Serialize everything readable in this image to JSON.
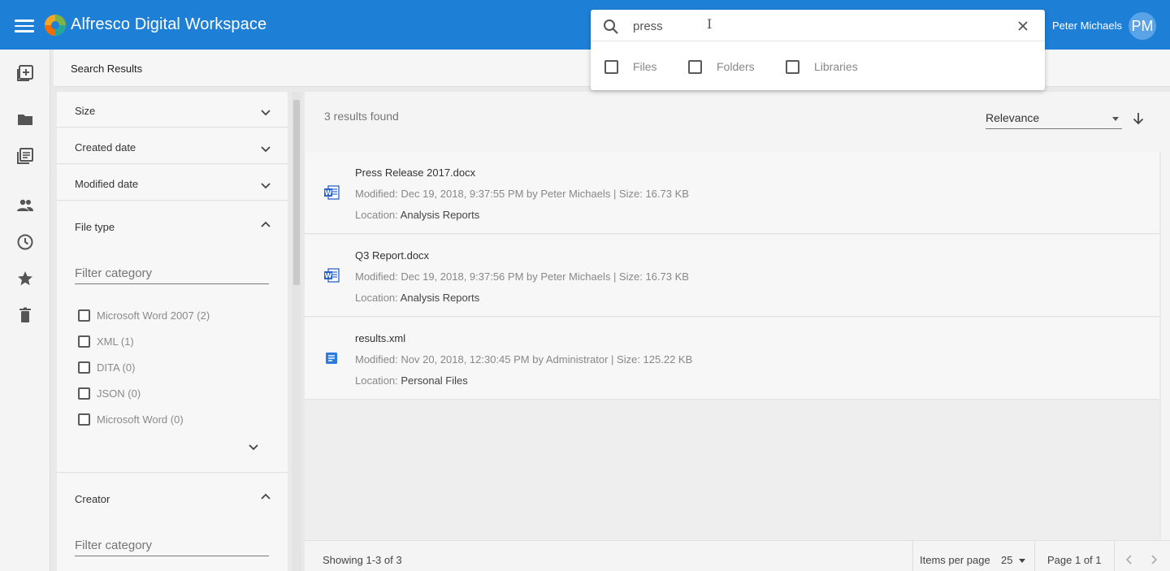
{
  "header": {
    "app_title": "Alfresco Digital Workspace",
    "user_name": "Peter Michaels",
    "user_initials": "PM",
    "bg_color": "#1e7fd6"
  },
  "search": {
    "query": "press",
    "options": [
      {
        "label": "Files",
        "checked": false
      },
      {
        "label": "Folders",
        "checked": false
      },
      {
        "label": "Libraries",
        "checked": false
      }
    ]
  },
  "left_nav": {
    "icons": [
      "create-icon",
      "folder-icon",
      "libraries-icon",
      "people-icon",
      "recent-icon",
      "favorites-icon",
      "trash-icon"
    ]
  },
  "page": {
    "title": "Search Results"
  },
  "filters": {
    "size": "Size",
    "created_date": "Created date",
    "modified_date": "Modified date",
    "file_type": "File type",
    "filter_placeholder": "Filter category",
    "file_types": [
      {
        "label": "Microsoft Word 2007 (2)"
      },
      {
        "label": "XML (1)"
      },
      {
        "label": "DITA (0)"
      },
      {
        "label": "JSON (0)"
      },
      {
        "label": "Microsoft Word (0)"
      }
    ],
    "creator": "Creator"
  },
  "results": {
    "count_text": "3 results found",
    "sort_label": "Relevance",
    "location_prefix": "Location:",
    "items": [
      {
        "name": "Press Release 2017.docx",
        "meta": "Modified: Dec 19, 2018, 9:37:55 PM by Peter Michaels | Size: 16.73 KB",
        "location": "Analysis Reports",
        "icon": "word-doc-icon"
      },
      {
        "name": "Q3 Report.docx",
        "meta": "Modified: Dec 19, 2018, 9:37:56 PM by Peter Michaels | Size: 16.73 KB",
        "location": "Analysis Reports",
        "icon": "word-doc-icon"
      },
      {
        "name": "results.xml",
        "meta": "Modified: Nov 20, 2018, 12:30:45 PM by Administrator | Size: 125.22 KB",
        "location": "Personal Files",
        "icon": "text-doc-icon"
      }
    ]
  },
  "footer": {
    "showing": "Showing 1-3 of 3",
    "items_per_page_label": "Items per page",
    "items_per_page": "25",
    "page_info": "Page 1 of 1"
  }
}
